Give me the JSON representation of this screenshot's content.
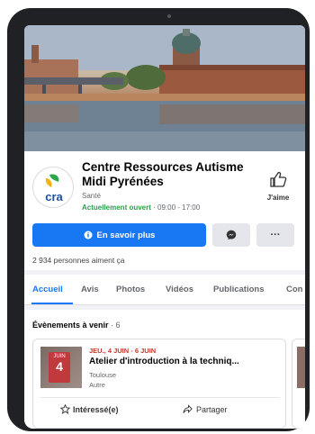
{
  "page": {
    "title": "Centre Ressources Autisme Midi Pyrénées",
    "logo_text": "cra",
    "category": "Santé",
    "open_label": "Actuellement ouvert",
    "hours": " · 09:00 - 17:00",
    "like_label": "J'aime",
    "learn_more_label": "En savoir plus",
    "more_label": "···",
    "likes_count": "2 934 personnes aiment ça"
  },
  "tabs": [
    {
      "label": "Accueil",
      "active": true
    },
    {
      "label": "Avis"
    },
    {
      "label": "Photos"
    },
    {
      "label": "Vidéos"
    },
    {
      "label": "Publications"
    },
    {
      "label": "Con"
    }
  ],
  "events": {
    "heading": "Évènements à venir",
    "count": " · 6",
    "card": {
      "cal_month": "JUIN",
      "cal_day": "4",
      "date": "JEU., 4 JUIN - 6 JUIN",
      "title": "Atelier d'introduction à la techniq...",
      "location": "Toulouse",
      "type": "Autre",
      "interested_label": "Intéressé(e)",
      "share_label": "Partager"
    }
  },
  "colors": {
    "accent": "#1877f2",
    "open_status": "#2e9d4a",
    "event_date": "#c0392b"
  }
}
